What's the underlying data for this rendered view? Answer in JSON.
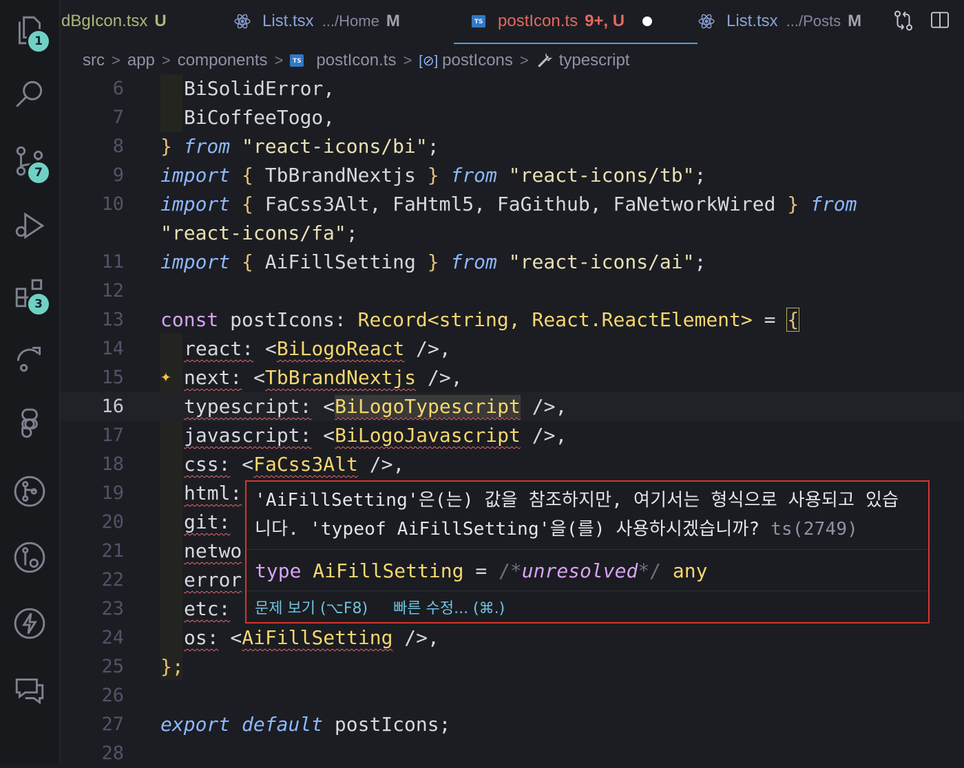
{
  "activity": {
    "explorer_badge": "1",
    "scm_badge": "7",
    "extensions_badge": "3"
  },
  "tabs": [
    {
      "label": "dBgIcon.tsx",
      "path": "",
      "status": "U",
      "status_color": "#a8b87a"
    },
    {
      "label": "List.tsx",
      "path": ".../Home",
      "status": "M",
      "status_color": "#c7b37a"
    },
    {
      "label": "postIcon.ts",
      "path": "",
      "status": "9+, U",
      "status_color": "#e2695f",
      "active": true
    },
    {
      "label": "List.tsx",
      "path": ".../Posts",
      "status": "M",
      "status_color": "#c7b37a"
    }
  ],
  "breadcrumb": [
    "src",
    "app",
    "components",
    "postIcon.ts",
    "postIcons",
    "typescript"
  ],
  "lines": {
    "n6": "6",
    "n7": "7",
    "n8": "8",
    "n9": "9",
    "n10": "10",
    "n11": "11",
    "n12": "12",
    "n13": "13",
    "n14": "14",
    "n15": "15",
    "n16": "16",
    "n17": "17",
    "n18": "18",
    "n19": "19",
    "n20": "20",
    "n21": "21",
    "n22": "22",
    "n23": "23",
    "n24": "24",
    "n25": "25",
    "n26": "26",
    "n27": "27",
    "n28": "28"
  },
  "code": {
    "l6": "BiSolidError,",
    "l7": "BiCoffeeTogo,",
    "l8_brace": "}",
    "kw_from": "from",
    "kw_import": "import",
    "s_bi": "\"react-icons/bi\"",
    "s_tb": "\"react-icons/tb\"",
    "s_fa": "\"react-icons/fa\"",
    "s_ai": "\"react-icons/ai\"",
    "tb_names": "TbBrandNextjs",
    "fa_names": "FaCss3Alt, FaHtml5, FaGithub, FaNetworkWired",
    "ai_names": "AiFillSetting",
    "kw_const": "const",
    "decl": "postIcons:",
    "record": "Record<string, React.ReactElement>",
    "eq": "=",
    "open": "{",
    "k_react": "react:",
    "t_react": "BiLogoReact",
    "k_next": "next:",
    "t_next": "TbBrandNextjs",
    "k_ts": "typescript:",
    "t_ts": "BiLogoTypescript",
    "k_js": "javascript:",
    "t_js": "BiLogoJavascript",
    "k_css": "css:",
    "t_css": "FaCss3Alt",
    "k_html": "html:",
    "k_git": "git:",
    "k_netwo": "netwo",
    "k_error": "error",
    "k_etc": "etc:",
    "k_os": "os:",
    "t_os": "AiFillSetting",
    "close": "};",
    "kw_export": "export",
    "kw_default": "default",
    "export_name": "postIcons;"
  },
  "hover": {
    "message_line1": "'AiFillSetting'은(는) 값을 참조하지만, 여기서는 형식으로 사용되고 있습",
    "message_line2": "니다. 'typeof AiFillSetting'을(를) 사용하시겠습니까?",
    "code_ref": "ts(2749)",
    "type_kw": "type",
    "type_name": "AiFillSetting",
    "type_eq": "=",
    "type_comment_open": "/*",
    "type_comment_body": "unresolved",
    "type_comment_close": "*/",
    "type_any": "any",
    "action_view": "문제 보기 (⌥F8)",
    "action_fix": "빠른 수정... (⌘.)"
  }
}
